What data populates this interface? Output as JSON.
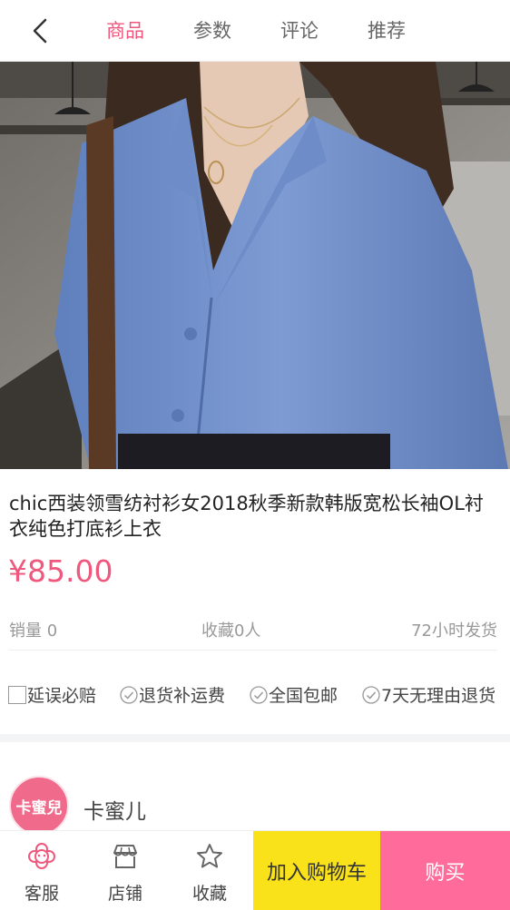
{
  "header": {
    "tabs": [
      {
        "label": "商品",
        "active": true
      },
      {
        "label": "参数",
        "active": false
      },
      {
        "label": "评论",
        "active": false
      },
      {
        "label": "推荐",
        "active": false
      }
    ]
  },
  "product": {
    "title": "chic西装领雪纺衬衫女2018秋季新款韩版宽松长袖OL衬衣纯色打底衫上衣",
    "price": "¥85.00",
    "sales": "销量 0",
    "favorites": "收藏0人",
    "shipping": "72小时发货",
    "guarantees": [
      "延误必赔",
      "退货补运费",
      "全国包邮",
      "7天无理由退货"
    ]
  },
  "shop": {
    "logo_text": "卡蜜兒",
    "name": "卡蜜儿"
  },
  "bottom_bar": {
    "service_label": "客服",
    "store_label": "店铺",
    "favorite_label": "收藏",
    "add_to_cart_label": "加入购物车",
    "buy_label": "购买"
  },
  "colors": {
    "accent": "#f0577d",
    "cart_button": "#f9e21a",
    "buy_button": "#ff6b9b"
  }
}
